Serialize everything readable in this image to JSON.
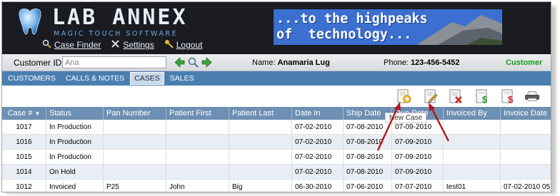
{
  "header": {
    "brand": "LAB ANNEX",
    "tagline": "MAGIC TOUCH SOFTWARE",
    "links": [
      {
        "label": "Case Finder",
        "icon": "search-icon"
      },
      {
        "label": "Settings",
        "icon": "tools-icon"
      },
      {
        "label": "Logout",
        "icon": "key-icon"
      }
    ],
    "banner_line1": "...to the highpeaks",
    "banner_line2": "of  technology..."
  },
  "customer_bar": {
    "customer_id_label": "Customer ID:",
    "customer_id_value": "Ana",
    "name_label": "Name:",
    "name_value": "Anamaria Lug",
    "phone_label": "Phone:",
    "phone_value": "123-456-5452",
    "status": "Customer",
    "status_color": "#1a9a1a"
  },
  "tabs": [
    {
      "label": "CUSTOMERS",
      "active": false
    },
    {
      "label": "CALLS & NOTES",
      "active": false
    },
    {
      "label": "CASES",
      "active": true
    },
    {
      "label": "SALES",
      "active": false
    }
  ],
  "toolbar": {
    "tooltip": "New Case",
    "buttons": [
      "new-case-icon",
      "edit-case-icon",
      "delete-case-icon",
      "invoice-add-icon",
      "invoice-remove-icon",
      "print-icon"
    ]
  },
  "grid": {
    "columns": [
      "Case #",
      "Status",
      "Pan Number",
      "Patient First",
      "Patient Last",
      "Date In",
      "Ship Date",
      "Due Date",
      "Invoiced By",
      "Invoice Date"
    ],
    "rows": [
      [
        "1017",
        "In Production",
        "",
        "",
        "",
        "07-02-2010",
        "07-08-2010",
        "07-09-2010",
        "",
        ""
      ],
      [
        "1016",
        "In Production",
        "",
        "",
        "",
        "07-02-2010",
        "07-08-2010",
        "07-09-2010",
        "",
        ""
      ],
      [
        "1015",
        "In Production",
        "",
        "",
        "",
        "07-02-2010",
        "07-08-2010",
        "07-09-2010",
        "",
        ""
      ],
      [
        "1014",
        "On Hold",
        "",
        "",
        "",
        "07-02-2010",
        "07-08-2010",
        "07-09-2010",
        "",
        ""
      ],
      [
        "1012",
        "Invoiced",
        "P25",
        "John",
        "Big",
        "06-30-2010",
        "07-06-2010",
        "07-07-2010",
        "test01",
        "07-02-2010 05:4"
      ]
    ]
  },
  "colors": {
    "header_bg": "#1a1c22",
    "tab_bar": "#4a7fb0",
    "grid_header": "#6d8fb3",
    "arrow": "#b01818"
  }
}
